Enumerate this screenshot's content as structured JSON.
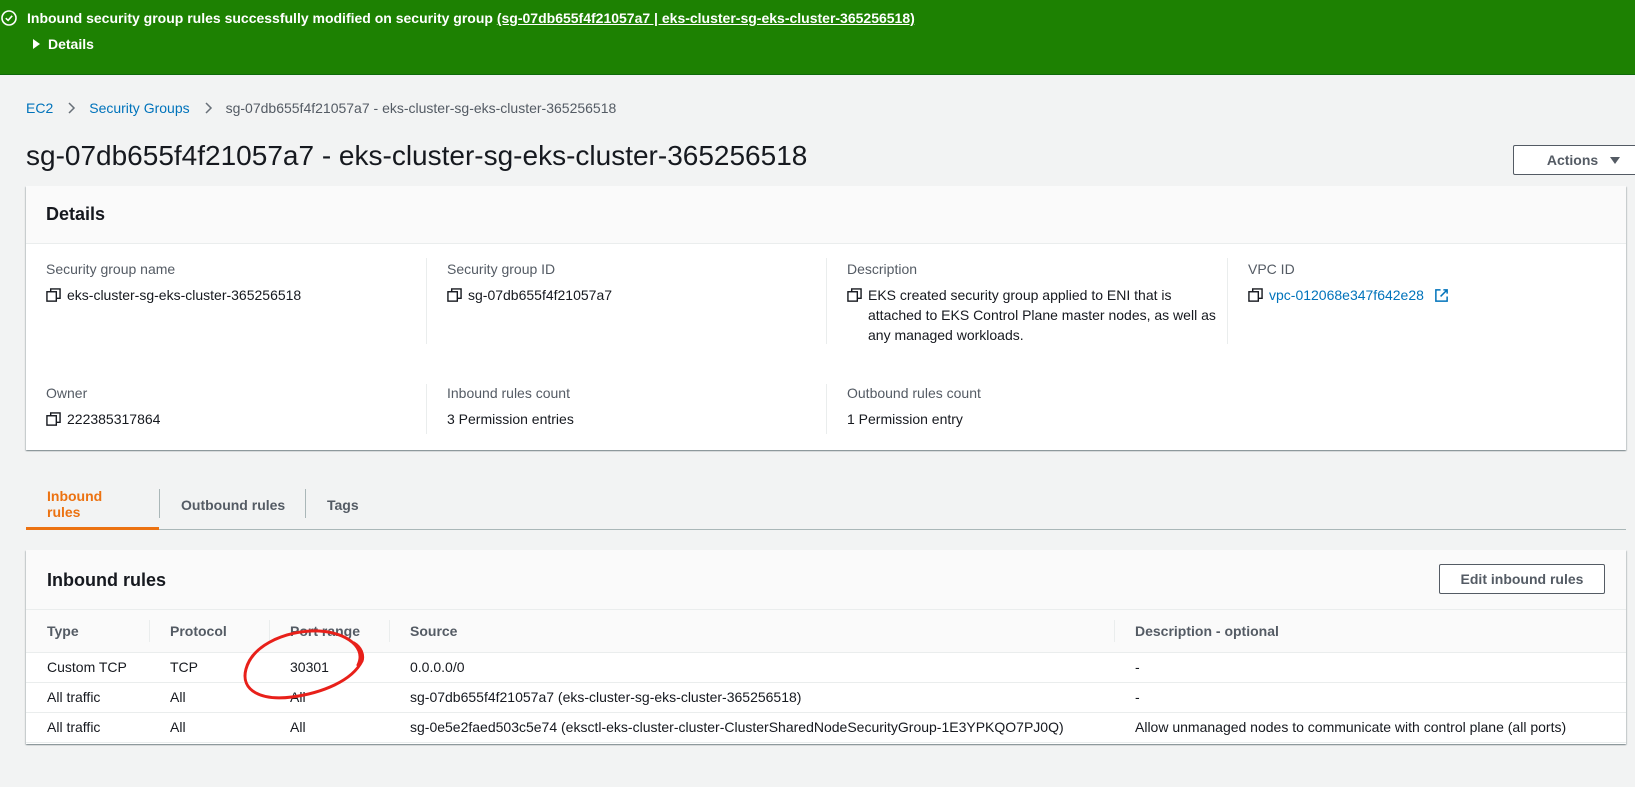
{
  "flash": {
    "message": "Inbound security group rules successfully modified on security group",
    "link_text": "(sg-07db655f4f21057a7 | eks-cluster-sg-eks-cluster-365256518)",
    "details_label": "Details",
    "color": "#1d8102"
  },
  "breadcrumb": {
    "items": [
      "EC2",
      "Security Groups",
      "sg-07db655f4f21057a7 - eks-cluster-sg-eks-cluster-365256518"
    ]
  },
  "page": {
    "title": "sg-07db655f4f21057a7 - eks-cluster-sg-eks-cluster-365256518",
    "actions_label": "Actions"
  },
  "details": {
    "header": "Details",
    "sg_name_label": "Security group name",
    "sg_name": "eks-cluster-sg-eks-cluster-365256518",
    "sg_id_label": "Security group ID",
    "sg_id": "sg-07db655f4f21057a7",
    "description_label": "Description",
    "description_lines": [
      "EKS created security group applied to ENI that is",
      "attached to EKS Control Plane master nodes, as well as",
      "any managed workloads."
    ],
    "vpc_label": "VPC ID",
    "vpc_id": "vpc-012068e347f642e28",
    "owner_label": "Owner",
    "owner": "222385317864",
    "inbound_count_label": "Inbound rules count",
    "inbound_count": "3 Permission entries",
    "outbound_count_label": "Outbound rules count",
    "outbound_count": "1 Permission entry"
  },
  "tabs": [
    {
      "label": "Inbound rules",
      "active": true
    },
    {
      "label": "Outbound rules",
      "active": false
    },
    {
      "label": "Tags",
      "active": false
    }
  ],
  "inbound": {
    "title": "Inbound rules",
    "edit_label": "Edit inbound rules",
    "columns": [
      "Type",
      "Protocol",
      "Port range",
      "Source",
      "Description - optional"
    ],
    "rows": [
      [
        "Custom TCP",
        "TCP",
        "30301",
        "0.0.0.0/0",
        "-"
      ],
      [
        "All traffic",
        "All",
        "All",
        "sg-07db655f4f21057a7 (eks-cluster-sg-eks-cluster-365256518)",
        "-"
      ],
      [
        "All traffic",
        "All",
        "All",
        "sg-0e5e2faed503c5e74 (eksctl-eks-cluster-cluster-ClusterSharedNodeSecurityGroup-1E3YPKQO7PJ0Q)",
        "Allow unmanaged nodes to communicate with control plane (all ports)"
      ]
    ]
  },
  "colors": {
    "link": "#0073bb",
    "active_tab": "#ec7211",
    "annotation": "#e8201a"
  }
}
